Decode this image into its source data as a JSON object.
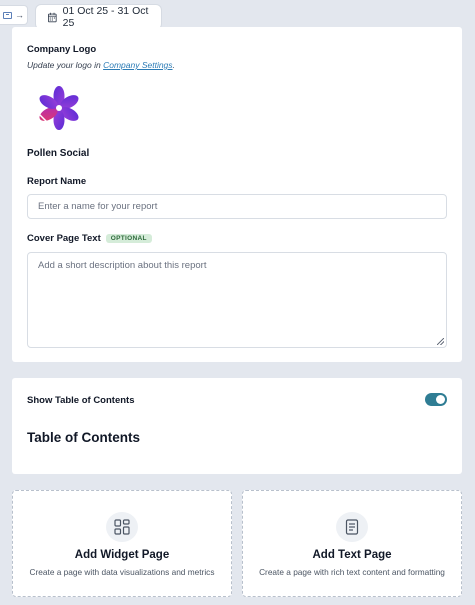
{
  "date_range": {
    "label": "01 Oct 25 - 31 Oct 25"
  },
  "company_logo": {
    "title": "Company Logo",
    "hint_prefix": "Update your logo in ",
    "hint_link": "Company Settings",
    "hint_suffix": ".",
    "company_name": "Pollen Social"
  },
  "report_name": {
    "label": "Report Name",
    "placeholder": "Enter a name for your report"
  },
  "cover_text": {
    "label": "Cover Page Text",
    "badge": "OPTIONAL",
    "placeholder": "Add a short description about this report"
  },
  "toc": {
    "toggle_label": "Show Table of Contents",
    "toggle_on": true,
    "heading": "Table of Contents"
  },
  "add_widget": {
    "title": "Add Widget Page",
    "description": "Create a page with data visualizations and metrics"
  },
  "add_text": {
    "title": "Add Text Page",
    "description": "Create a page with rich text content and formatting"
  },
  "icons": {
    "sidebar_toggle": "sidebar-panel-icon",
    "calendar": "calendar-icon",
    "widget": "grid-layout-icon",
    "text": "document-icon"
  },
  "colors": {
    "background": "#e3e7ee",
    "toggle_on": "#2f7d94",
    "link": "#2b7bb5",
    "badge_bg": "#d5ecd9",
    "badge_text": "#2f6b3c"
  }
}
